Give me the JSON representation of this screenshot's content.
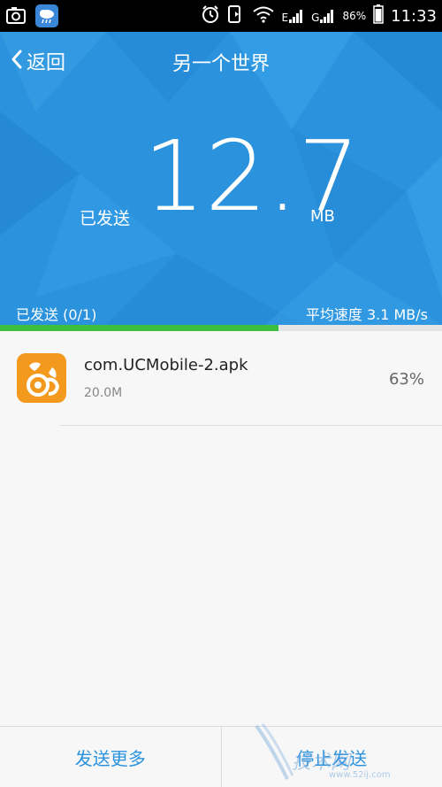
{
  "status_bar": {
    "left_icons": [
      "camera-icon",
      "weather-cloud-icon"
    ],
    "right_icons": [
      "alarm-icon",
      "nfc-phone-icon",
      "wifi-icon",
      "signal-e-icon",
      "signal-g-icon",
      "battery-icon"
    ],
    "network_1": "E",
    "network_2": "G",
    "battery": "86%",
    "time": "11:33"
  },
  "header": {
    "back_label": "返回",
    "title": "另一个世界"
  },
  "transfer": {
    "sent_label": "已发送",
    "amount_int": "12",
    "amount_dec": ".7",
    "unit": "MB",
    "sent_count": "已发送 (0/1)",
    "avg_speed": "平均速度 3.1 MB/s",
    "progress": 0.63
  },
  "files": [
    {
      "name": "com.UCMobile-2.apk",
      "size": "20.0M",
      "percent": "63%",
      "icon": "uc-browser-icon"
    }
  ],
  "actions": {
    "send_more": "发送更多",
    "stop_send": "停止发送"
  },
  "watermark": {
    "text": "技术网",
    "url": "www.52ij.com"
  },
  "colors": {
    "accent": "#2b93de",
    "progress": "#3cbf3c",
    "app_icon": "#f39a1e"
  }
}
